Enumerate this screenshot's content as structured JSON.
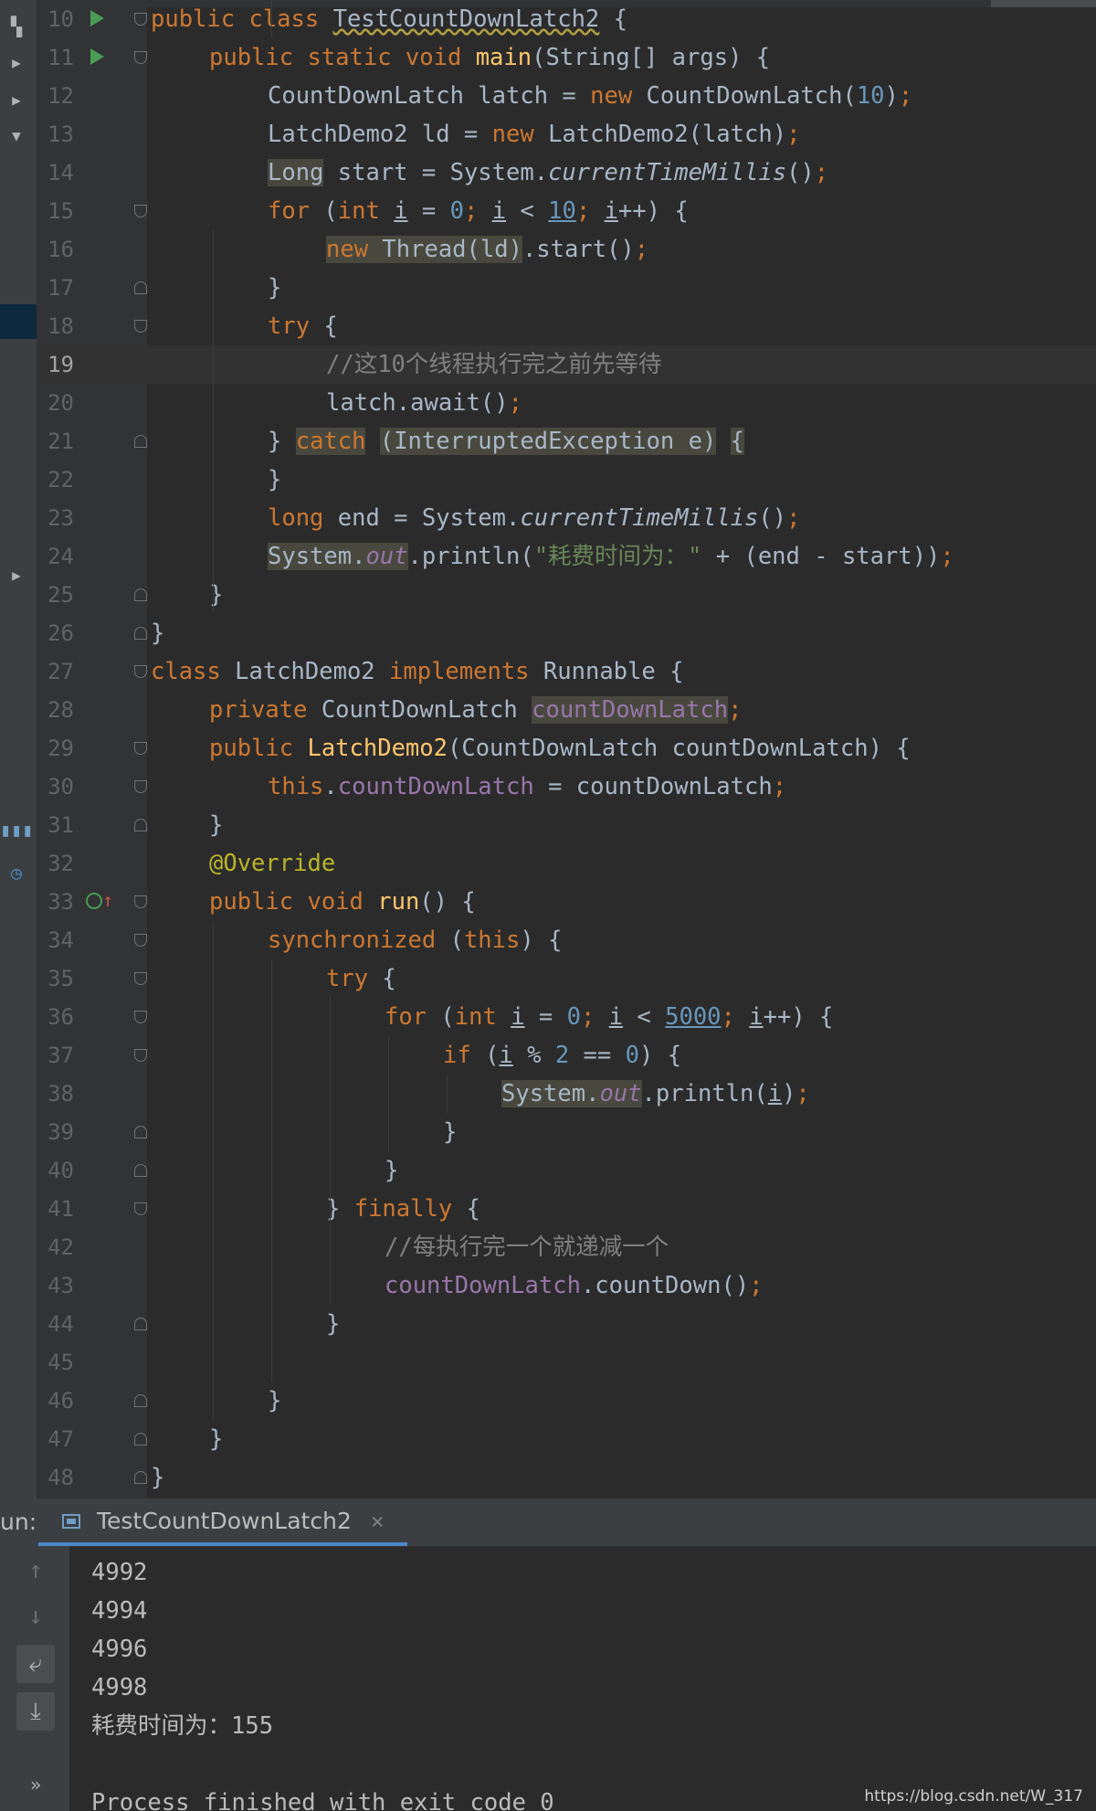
{
  "editor": {
    "current_line": "19",
    "lines": [
      {
        "n": "10",
        "gutter": "run",
        "fold": "open",
        "indent": 0,
        "tokens": [
          [
            "kw",
            "public class "
          ],
          [
            "wav",
            "TestCountDownLatch2"
          ],
          [
            "p",
            " {"
          ]
        ]
      },
      {
        "n": "11",
        "gutter": "run",
        "fold": "open",
        "indent": 1,
        "tokens": [
          [
            "kw",
            "public static void "
          ],
          [
            "mth",
            "main"
          ],
          [
            "p",
            "(String[] args) {"
          ]
        ]
      },
      {
        "n": "12",
        "indent": 2,
        "tokens": [
          [
            "p",
            "CountDownLatch latch = "
          ],
          [
            "kw",
            "new "
          ],
          [
            "p",
            "CountDownLatch("
          ],
          [
            "num",
            "10"
          ],
          [
            "p",
            ")"
          ],
          [
            "kw",
            ";"
          ]
        ]
      },
      {
        "n": "13",
        "indent": 2,
        "tokens": [
          [
            "p",
            "LatchDemo2 ld = "
          ],
          [
            "kw",
            "new "
          ],
          [
            "p",
            "LatchDemo2(latch)"
          ],
          [
            "kw",
            ";"
          ]
        ]
      },
      {
        "n": "14",
        "indent": 2,
        "tokens": [
          [
            "hl",
            "Long"
          ],
          [
            "p",
            " start = System."
          ],
          [
            "it",
            "currentTimeMillis"
          ],
          [
            "p",
            "()"
          ],
          [
            "kw",
            ";"
          ]
        ]
      },
      {
        "n": "15",
        "fold": "open",
        "indent": 2,
        "tokens": [
          [
            "kw",
            "for "
          ],
          [
            "p",
            "("
          ],
          [
            "kw",
            "int "
          ],
          [
            "ul",
            "i"
          ],
          [
            "p",
            " = "
          ],
          [
            "num",
            "0"
          ],
          [
            "kw",
            "; "
          ],
          [
            "ul",
            "i"
          ],
          [
            "p",
            " < "
          ],
          [
            "num ul",
            "10"
          ],
          [
            "kw",
            "; "
          ],
          [
            "ul",
            "i"
          ],
          [
            "p",
            "++) {"
          ]
        ]
      },
      {
        "n": "16",
        "indent": 3,
        "tokens": [
          [
            "kw hl",
            "new "
          ],
          [
            "hl",
            "Thread(ld)"
          ],
          [
            "p",
            ".start()"
          ],
          [
            "kw",
            ";"
          ]
        ]
      },
      {
        "n": "17",
        "fold": "close",
        "indent": 2,
        "tokens": [
          [
            "p",
            "}"
          ]
        ]
      },
      {
        "n": "18",
        "fold": "open",
        "indent": 2,
        "tokens": [
          [
            "kw",
            "try "
          ],
          [
            "p",
            "{"
          ]
        ]
      },
      {
        "n": "19",
        "indent": 3,
        "tokens": [
          [
            "cmt",
            "//这10个线程执行完之前先等待"
          ]
        ]
      },
      {
        "n": "20",
        "indent": 3,
        "tokens": [
          [
            "p",
            "latch.await()"
          ],
          [
            "kw",
            ";"
          ]
        ]
      },
      {
        "n": "21",
        "fold": "close",
        "indent": 2,
        "tokens": [
          [
            "p",
            "} "
          ],
          [
            "kw hl",
            "catch"
          ],
          [
            "p",
            " "
          ],
          [
            "hl",
            "(InterruptedException e)"
          ],
          [
            "p",
            " "
          ],
          [
            "hl",
            "{"
          ]
        ]
      },
      {
        "n": "22",
        "indent": 2,
        "tokens": [
          [
            "p",
            "}"
          ]
        ]
      },
      {
        "n": "23",
        "indent": 2,
        "tokens": [
          [
            "kw",
            "long "
          ],
          [
            "p",
            "end = System."
          ],
          [
            "it",
            "currentTimeMillis"
          ],
          [
            "p",
            "()"
          ],
          [
            "kw",
            ";"
          ]
        ]
      },
      {
        "n": "24",
        "indent": 2,
        "tokens": [
          [
            "hl",
            "System."
          ],
          [
            "sfld hl",
            "out"
          ],
          [
            "p",
            ".println("
          ],
          [
            "str",
            "\"耗费时间为：\""
          ],
          [
            "p",
            " + (end - start))"
          ],
          [
            "kw",
            ";"
          ]
        ]
      },
      {
        "n": "25",
        "fold": "close",
        "indent": 1,
        "tokens": [
          [
            "p",
            "}"
          ]
        ]
      },
      {
        "n": "26",
        "fold": "close",
        "indent": 0,
        "tokens": [
          [
            "p",
            "}"
          ]
        ]
      },
      {
        "n": "27",
        "fold": "open",
        "indent": 0,
        "tokens": [
          [
            "kw",
            "class "
          ],
          [
            "p",
            "LatchDemo2 "
          ],
          [
            "kw",
            "implements "
          ],
          [
            "p",
            "Runnable {"
          ]
        ]
      },
      {
        "n": "28",
        "indent": 1,
        "tokens": [
          [
            "kw",
            "private "
          ],
          [
            "p",
            "CountDownLatch "
          ],
          [
            "fld hl",
            "countDownLatch"
          ],
          [
            "kw",
            ";"
          ]
        ]
      },
      {
        "n": "29",
        "fold": "open",
        "indent": 1,
        "tokens": [
          [
            "kw",
            "public "
          ],
          [
            "mth",
            "LatchDemo2"
          ],
          [
            "p",
            "(CountDownLatch countDownLatch) {"
          ]
        ]
      },
      {
        "n": "30",
        "fold": "open",
        "indent": 2,
        "tokens": [
          [
            "kw",
            "this"
          ],
          [
            "p",
            "."
          ],
          [
            "fld",
            "countDownLatch"
          ],
          [
            "p",
            " = countDownLatch"
          ],
          [
            "kw",
            ";"
          ]
        ]
      },
      {
        "n": "31",
        "fold": "close",
        "indent": 1,
        "tokens": [
          [
            "p",
            "}"
          ]
        ]
      },
      {
        "n": "32",
        "indent": 1,
        "tokens": [
          [
            "ann",
            "@Override"
          ]
        ]
      },
      {
        "n": "33",
        "gutter": "impl",
        "fold": "open",
        "indent": 1,
        "tokens": [
          [
            "kw",
            "public void "
          ],
          [
            "mth",
            "run"
          ],
          [
            "p",
            "() {"
          ]
        ]
      },
      {
        "n": "34",
        "fold": "open",
        "indent": 2,
        "tokens": [
          [
            "kw",
            "synchronized "
          ],
          [
            "p",
            "("
          ],
          [
            "kw",
            "this"
          ],
          [
            "p",
            ") {"
          ]
        ]
      },
      {
        "n": "35",
        "fold": "open",
        "indent": 3,
        "tokens": [
          [
            "kw",
            "try "
          ],
          [
            "p",
            "{"
          ]
        ]
      },
      {
        "n": "36",
        "fold": "open",
        "indent": 4,
        "tokens": [
          [
            "kw",
            "for "
          ],
          [
            "p",
            "("
          ],
          [
            "kw",
            "int "
          ],
          [
            "ul",
            "i"
          ],
          [
            "p",
            " = "
          ],
          [
            "num",
            "0"
          ],
          [
            "kw",
            "; "
          ],
          [
            "ul",
            "i"
          ],
          [
            "p",
            " < "
          ],
          [
            "num ul",
            "5000"
          ],
          [
            "kw",
            "; "
          ],
          [
            "ul",
            "i"
          ],
          [
            "p",
            "++) {"
          ]
        ]
      },
      {
        "n": "37",
        "fold": "open",
        "indent": 5,
        "tokens": [
          [
            "kw",
            "if "
          ],
          [
            "p",
            "("
          ],
          [
            "ul",
            "i"
          ],
          [
            "p",
            " % "
          ],
          [
            "num",
            "2"
          ],
          [
            "p",
            " == "
          ],
          [
            "num",
            "0"
          ],
          [
            "p",
            ") {"
          ]
        ]
      },
      {
        "n": "38",
        "indent": 6,
        "tokens": [
          [
            "hl",
            "System."
          ],
          [
            "sfld hl",
            "out"
          ],
          [
            "p",
            ".println("
          ],
          [
            "ul",
            "i"
          ],
          [
            "p",
            ")"
          ],
          [
            "kw",
            ";"
          ]
        ]
      },
      {
        "n": "39",
        "fold": "close",
        "indent": 5,
        "tokens": [
          [
            "p",
            "}"
          ]
        ]
      },
      {
        "n": "40",
        "fold": "close",
        "indent": 4,
        "tokens": [
          [
            "p",
            "}"
          ]
        ]
      },
      {
        "n": "41",
        "fold": "open",
        "indent": 3,
        "tokens": [
          [
            "p",
            "} "
          ],
          [
            "kw",
            "finally "
          ],
          [
            "p",
            "{"
          ]
        ]
      },
      {
        "n": "42",
        "indent": 4,
        "tokens": [
          [
            "cmt",
            "//每执行完一个就递减一个"
          ]
        ]
      },
      {
        "n": "43",
        "indent": 4,
        "tokens": [
          [
            "fld",
            "countDownLatch"
          ],
          [
            "p",
            ".countDown()"
          ],
          [
            "kw",
            ";"
          ]
        ]
      },
      {
        "n": "44",
        "fold": "close",
        "indent": 3,
        "tokens": [
          [
            "p",
            "}"
          ]
        ]
      },
      {
        "n": "45",
        "indent": 0,
        "tokens": []
      },
      {
        "n": "46",
        "fold": "close",
        "indent": 2,
        "tokens": [
          [
            "p",
            "}"
          ]
        ]
      },
      {
        "n": "47",
        "fold": "close",
        "indent": 1,
        "tokens": [
          [
            "p",
            "}"
          ]
        ]
      },
      {
        "n": "48",
        "fold": "close",
        "indent": 0,
        "tokens": [
          [
            "p",
            "}"
          ]
        ]
      }
    ]
  },
  "run_panel": {
    "label": "un:",
    "tab_title": "TestCountDownLatch2",
    "close_glyph": "×",
    "output_lines": [
      "4992",
      "4994",
      "4996",
      "4998",
      "耗费时间为：155",
      "",
      "Process finished with exit code 0"
    ]
  },
  "console_tools": {
    "up": "↑",
    "down": "↓",
    "wrap": "⤶",
    "scroll_end": "⤓",
    "more": "»"
  },
  "watermark": "https://blog.csdn.net/W_317",
  "colors": {
    "keyword": "#cc7832",
    "number": "#6897bb",
    "string": "#6a8759",
    "comment": "#808080",
    "field": "#9876aa",
    "method": "#ffc66d",
    "annotation": "#bbb529",
    "text": "#a9b7c6",
    "background": "#2b2b2b",
    "tab_accent": "#4a88c7"
  }
}
